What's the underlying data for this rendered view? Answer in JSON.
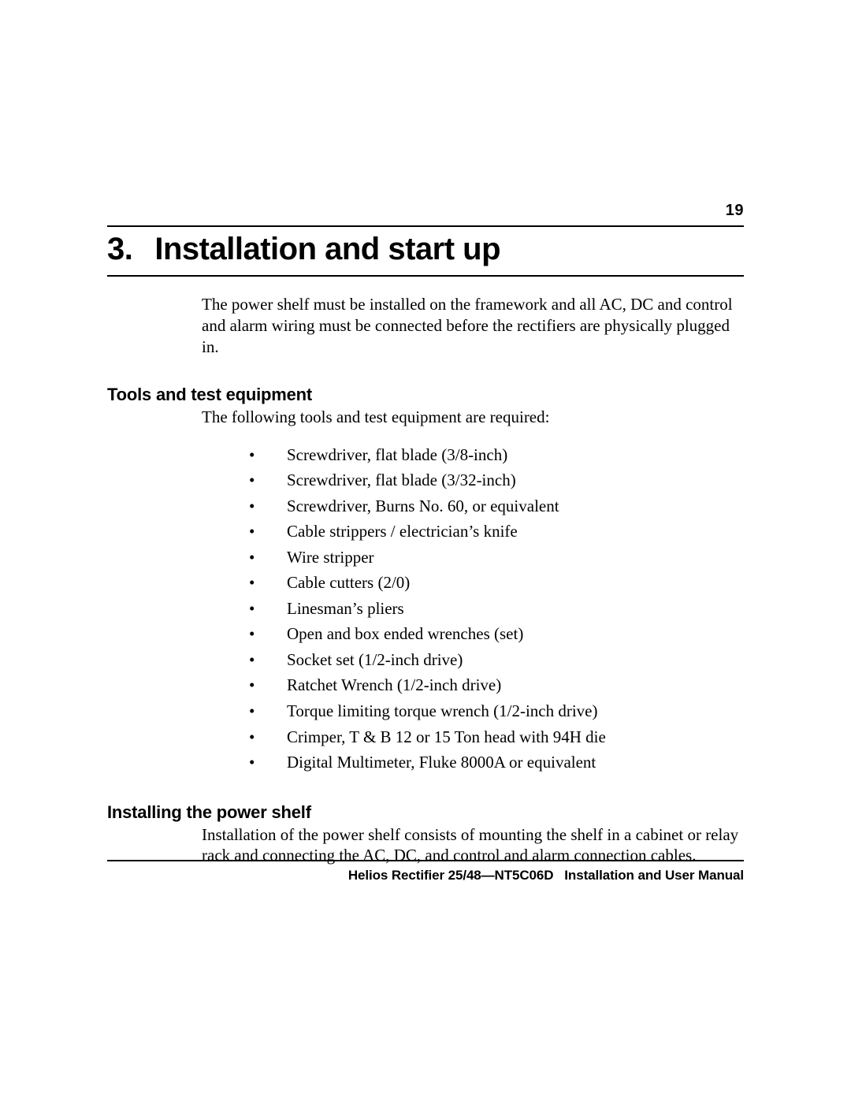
{
  "page_number": "19",
  "chapter": {
    "number": "3",
    "title": "Installation and start up"
  },
  "intro_paragraph": "The power shelf must be installed on the framework and all AC, DC and control and alarm wiring must be connected before the rectifiers are physically plugged in.",
  "section_tools": {
    "heading": "Tools and test equipment",
    "intro": "The following tools and test equipment are required:",
    "items": [
      "Screwdriver, flat blade (3/8-inch)",
      "Screwdriver, flat blade (3/32-inch)",
      "Screwdriver, Burns No. 60, or equivalent",
      "Cable strippers / electrician’s knife",
      "Wire stripper",
      "Cable cutters (2/0)",
      "Linesman’s pliers",
      "Open and box ended wrenches (set)",
      "Socket set (1/2-inch drive)",
      "Ratchet Wrench (1/2-inch drive)",
      "Torque limiting torque wrench (1/2-inch drive)",
      "Crimper, T & B 12 or 15 Ton head with 94H die",
      "Digital Multimeter, Fluke 8000A or equivalent"
    ]
  },
  "section_install": {
    "heading": "Installing the power shelf",
    "body": "Installation of the power shelf consists of mounting the shelf in a cabinet or relay rack and connecting the AC, DC, and control and alarm connection cables."
  },
  "footer": "Helios Rectifier 25/48—NT5C06D   Installation and User Manual"
}
